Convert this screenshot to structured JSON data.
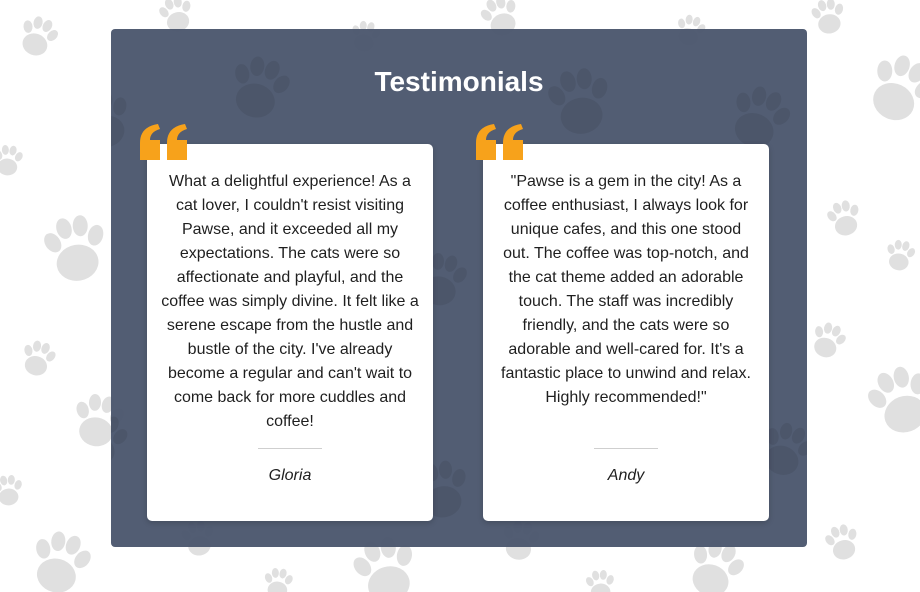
{
  "page": {
    "background_color": "#ffffff",
    "pattern_icon": "paw-print-icon",
    "pattern_color": "#e0e0e0"
  },
  "testimonials": {
    "title": "Testimonials",
    "panel_color": "#4b566d",
    "quote_icon": "quote-icon",
    "quote_color": "#f7a21b",
    "items": [
      {
        "text": "What a delightful experience! As a cat lover, I couldn't resist visiting Pawse, and it exceeded all my expectations. The cats were so affectionate and playful, and the coffee was simply divine. It felt like a serene escape from the hustle and bustle of the city. I've already become a regular and can't wait to come back for more cuddles and coffee!",
        "author": "Gloria"
      },
      {
        "text": "\"Pawse is a gem in the city! As a coffee enthusiast, I always look for unique cafes, and this one stood out. The coffee was top-notch, and the cat theme added an adorable touch. The staff was incredibly friendly, and the cats were so adorable and well-cared for. It's a fantastic place to unwind and relax. Highly recommended!\"",
        "author": "Andy"
      }
    ]
  }
}
